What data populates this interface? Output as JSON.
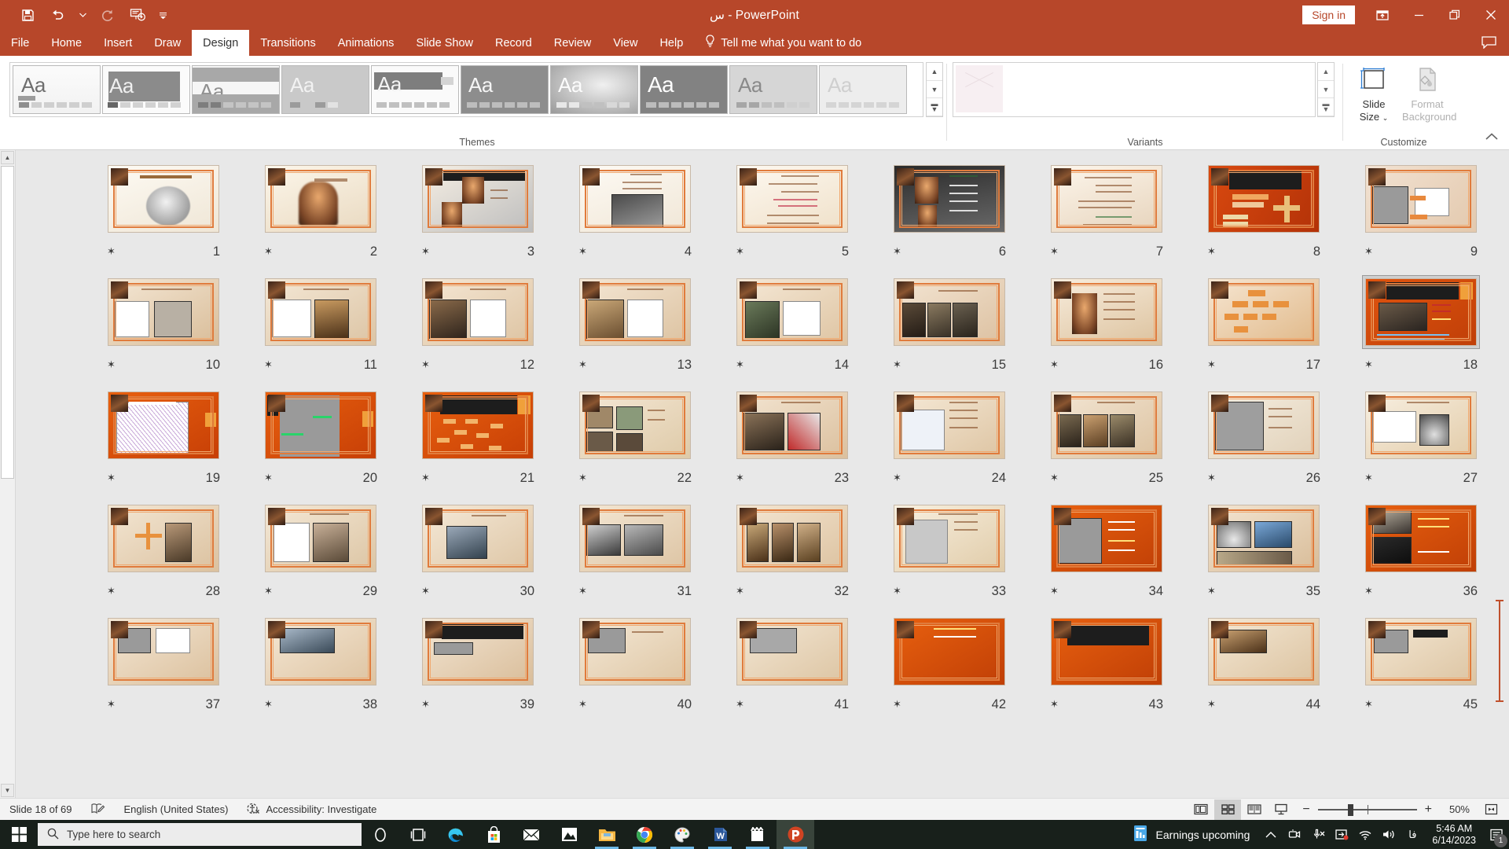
{
  "window": {
    "title": "س - PowerPoint",
    "signin_label": "Sign in",
    "quick_access": [
      {
        "name": "save-icon",
        "label": "Save"
      },
      {
        "name": "undo-icon",
        "label": "Undo"
      },
      {
        "name": "undo-dropdown-icon",
        "label": "Undo options"
      },
      {
        "name": "redo-icon",
        "label": "Redo"
      },
      {
        "name": "start-presentation-icon",
        "label": "Start From Beginning"
      },
      {
        "name": "customize-quick-access-icon",
        "label": "Customize Quick Access Toolbar"
      }
    ],
    "controls": {
      "ribbon_display_options": "Ribbon Display Options",
      "minimize": "Minimize",
      "restore": "Restore Down",
      "close": "Close"
    }
  },
  "ribbon": {
    "tabs": [
      {
        "label": "File",
        "active": false
      },
      {
        "label": "Home",
        "active": false
      },
      {
        "label": "Insert",
        "active": false
      },
      {
        "label": "Draw",
        "active": false
      },
      {
        "label": "Design",
        "active": true
      },
      {
        "label": "Transitions",
        "active": false
      },
      {
        "label": "Animations",
        "active": false
      },
      {
        "label": "Slide Show",
        "active": false
      },
      {
        "label": "Record",
        "active": false
      },
      {
        "label": "Review",
        "active": false
      },
      {
        "label": "View",
        "active": false
      },
      {
        "label": "Help",
        "active": false
      }
    ],
    "tell_me": "Tell me what you want to do",
    "groups": {
      "themes": {
        "label": "Themes",
        "items": [
          {
            "aa": "Aa"
          },
          {
            "aa": "Aa"
          },
          {
            "aa": "Aa"
          },
          {
            "aa": "Aa"
          },
          {
            "aa": "Aa"
          },
          {
            "aa": "Aa"
          },
          {
            "aa": "Aa"
          },
          {
            "aa": "Aa"
          },
          {
            "aa": "Aa"
          },
          {
            "aa": "Aa"
          }
        ]
      },
      "variants": {
        "label": "Variants"
      },
      "customize": {
        "label": "Customize",
        "slide_size": "Slide\nSize",
        "slide_size_line1": "Slide",
        "slide_size_line2": "Size",
        "format_background_line1": "Format",
        "format_background_line2": "Background",
        "format_background_disabled": true
      }
    },
    "collapse_label": "Collapse the Ribbon"
  },
  "sorter": {
    "slides": [
      {
        "n": "9",
        "style": "plan-arrow"
      },
      {
        "n": "8",
        "style": "orange-diagram"
      },
      {
        "n": "7",
        "style": "cream-text"
      },
      {
        "n": "6",
        "style": "dark-arch"
      },
      {
        "n": "5",
        "style": "cream-list"
      },
      {
        "n": "4",
        "style": "photo-center"
      },
      {
        "n": "3",
        "style": "dark-arch2"
      },
      {
        "n": "2",
        "style": "title-cream"
      },
      {
        "n": "1",
        "style": "bismillah"
      },
      {
        "n": "18",
        "style": "photo-dark",
        "selected": true
      },
      {
        "n": "17",
        "style": "orange-tree"
      },
      {
        "n": "16",
        "style": "arch-center"
      },
      {
        "n": "15",
        "style": "photo-strip"
      },
      {
        "n": "14",
        "style": "photo-sketch"
      },
      {
        "n": "13",
        "style": "photo-plan"
      },
      {
        "n": "12",
        "style": "photo-plan2"
      },
      {
        "n": "11",
        "style": "plan-photo"
      },
      {
        "n": "10",
        "style": "plan-dark"
      },
      {
        "n": "27",
        "style": "plan-dome"
      },
      {
        "n": "26",
        "style": "sketch-gray"
      },
      {
        "n": "25",
        "style": "photo-row"
      },
      {
        "n": "24",
        "style": "plan-blue"
      },
      {
        "n": "23",
        "style": "photo-red"
      },
      {
        "n": "22",
        "style": "photo-collage"
      },
      {
        "n": "21",
        "style": "orange-network"
      },
      {
        "n": "20",
        "style": "map-gray"
      },
      {
        "n": "19",
        "style": "map-white"
      },
      {
        "n": "36",
        "style": "photo-dark2"
      },
      {
        "n": "35",
        "style": "photo-domes"
      },
      {
        "n": "34",
        "style": "plan-dark2"
      },
      {
        "n": "33",
        "style": "plan-cream"
      },
      {
        "n": "32",
        "style": "photo-triple"
      },
      {
        "n": "31",
        "style": "photo-bw"
      },
      {
        "n": "30",
        "style": "photo-single"
      },
      {
        "n": "29",
        "style": "plan-cross"
      },
      {
        "n": "28",
        "style": "photo-cross"
      },
      {
        "n": "45",
        "style": "plan-partial"
      },
      {
        "n": "44",
        "style": "photo-partial"
      },
      {
        "n": "43",
        "style": "dark-partial"
      },
      {
        "n": "42",
        "style": "text-partial"
      },
      {
        "n": "41",
        "style": "gray-partial"
      },
      {
        "n": "40",
        "style": "plan-partial2"
      },
      {
        "n": "39",
        "style": "dark-partial2"
      },
      {
        "n": "38",
        "style": "photo-partial2"
      },
      {
        "n": "37",
        "style": "plan-partial3"
      }
    ],
    "animation_star": "✶"
  },
  "status": {
    "slide_counter": "Slide 18 of 69",
    "language": "English (United States)",
    "accessibility": "Accessibility: Investigate",
    "views": [
      {
        "name": "normal-view-button",
        "label": "Normal",
        "active": false
      },
      {
        "name": "slide-sorter-view-button",
        "label": "Slide Sorter",
        "active": true
      },
      {
        "name": "reading-view-button",
        "label": "Reading View",
        "active": false
      },
      {
        "name": "slide-show-button",
        "label": "Slide Show",
        "active": false
      }
    ],
    "zoom_out": "−",
    "zoom_in": "+",
    "zoom_value": "50%",
    "fit_label": "Fit slide to current window"
  },
  "taskbar": {
    "search_placeholder": "Type here to search",
    "apps": [
      {
        "name": "cortana-icon",
        "label": "Cortana"
      },
      {
        "name": "task-view-icon",
        "label": "Task View"
      },
      {
        "name": "edge-icon",
        "label": "Microsoft Edge"
      },
      {
        "name": "microsoft-store-icon",
        "label": "Microsoft Store"
      },
      {
        "name": "mail-icon",
        "label": "Mail"
      },
      {
        "name": "photos-icon",
        "label": "Photos"
      },
      {
        "name": "file-explorer-icon",
        "label": "File Explorer"
      },
      {
        "name": "chrome-icon",
        "label": "Google Chrome"
      },
      {
        "name": "paint-icon",
        "label": "Paint"
      },
      {
        "name": "word-icon",
        "label": "Microsoft Word"
      },
      {
        "name": "video-editor-icon",
        "label": "Video Editor"
      },
      {
        "name": "powerpoint-icon",
        "label": "Microsoft PowerPoint"
      }
    ],
    "news": "Earnings upcoming",
    "time": "5:46 AM",
    "date": "6/14/2023",
    "notification_count": "1"
  },
  "colors": {
    "brand": "#b7472a",
    "accent": "#e07b3c",
    "taskbar": "#18201b",
    "workspace": "#e8e8e8"
  }
}
